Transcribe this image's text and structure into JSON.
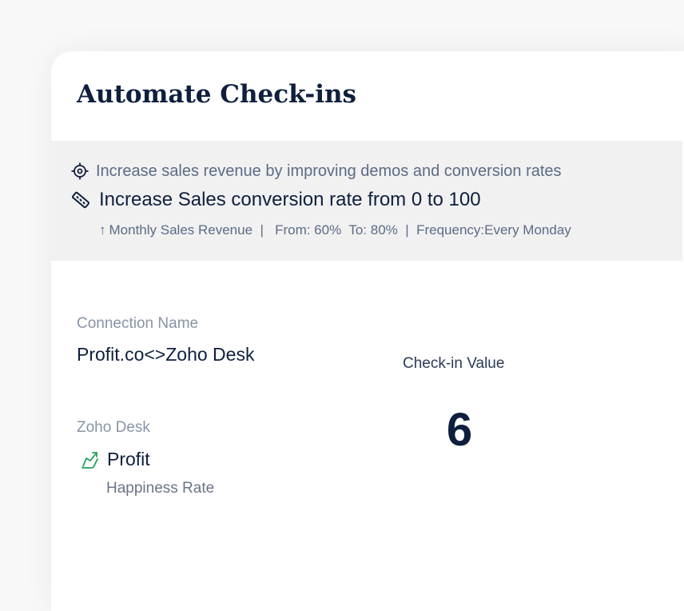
{
  "card": {
    "title": "Automate Check-ins"
  },
  "objective": {
    "icon": "target-icon",
    "text": "Increase sales revenue by improving demos and conversion rates"
  },
  "key_result": {
    "icon": "ruler-icon",
    "text": "Increase Sales conversion rate from 0 to 100",
    "meta": {
      "arrow": "↑",
      "text": "Monthly Sales Revenue  |   From: 60%  To: 80%  |  Frequency:Every Monday"
    }
  },
  "connection": {
    "label": "Connection Name",
    "value": "Profit.co<>Zoho Desk"
  },
  "source": {
    "label": "Zoho Desk",
    "icon": "profit-chart-icon",
    "name": "Profit",
    "metric": "Happiness Rate"
  },
  "checkin": {
    "label": "Check-in Value",
    "value": "6"
  },
  "colors": {
    "navy": "#0f1f3d",
    "muted": "#5d6b85",
    "panel": "#f1f1f1",
    "green": "#22a05a"
  }
}
